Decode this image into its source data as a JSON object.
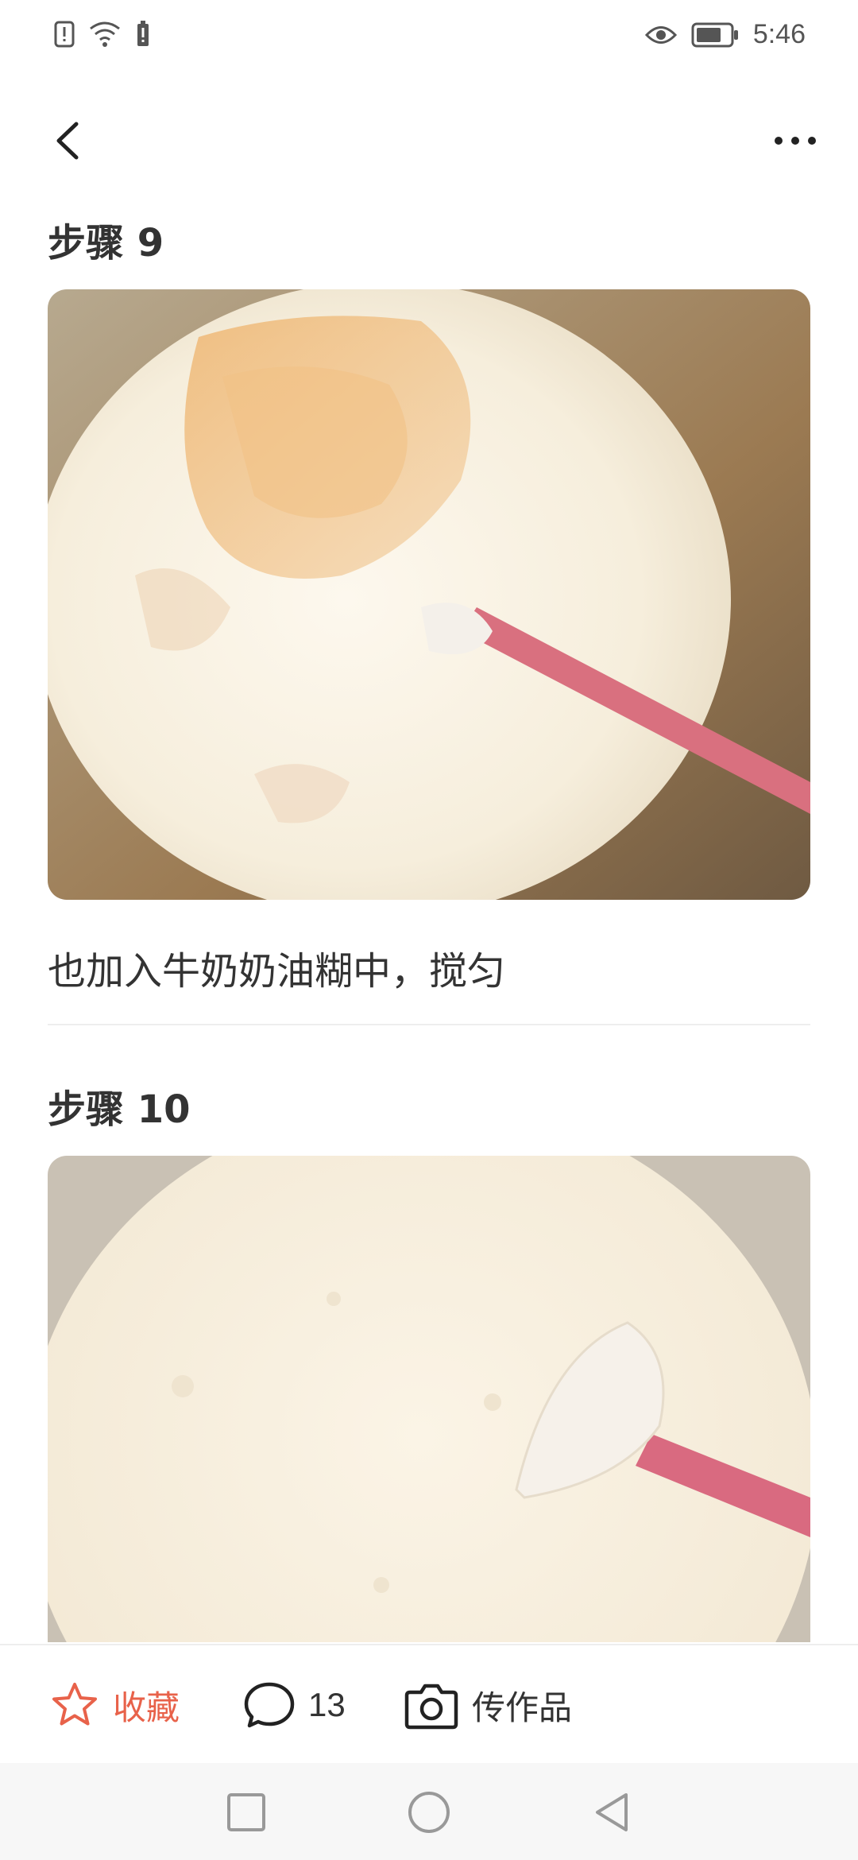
{
  "status": {
    "time": "5:46"
  },
  "steps": [
    {
      "title": "步骤 9",
      "description": "也加入牛奶奶油糊中，搅匀"
    },
    {
      "title": "步骤 10"
    }
  ],
  "actions": {
    "favorite_label": "收藏",
    "comment_count": "13",
    "upload_label": "传作品"
  },
  "colors": {
    "accent": "#E8624A",
    "text": "#333333",
    "divider": "#EEEEEE"
  },
  "icons": {
    "back": "chevron-left-icon",
    "more": "more-horizontal-icon",
    "favorite": "star-icon",
    "comment": "comment-bubble-icon",
    "upload": "camera-icon"
  }
}
